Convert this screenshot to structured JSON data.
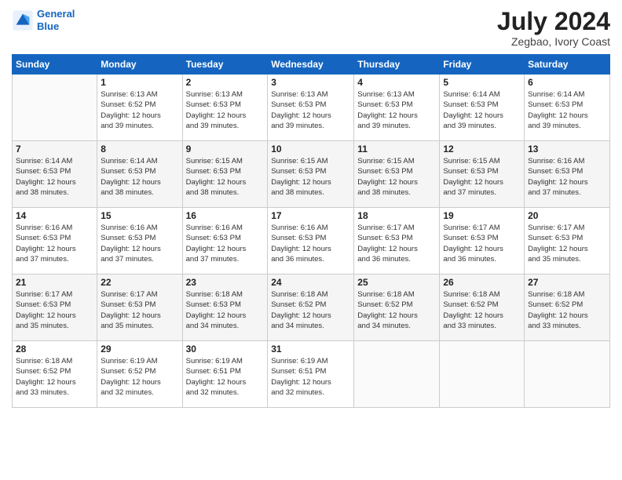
{
  "header": {
    "logo_line1": "General",
    "logo_line2": "Blue",
    "title": "July 2024",
    "subtitle": "Zegbao, Ivory Coast"
  },
  "days_of_week": [
    "Sunday",
    "Monday",
    "Tuesday",
    "Wednesday",
    "Thursday",
    "Friday",
    "Saturday"
  ],
  "weeks": [
    [
      {
        "day": "",
        "info": ""
      },
      {
        "day": "1",
        "info": "Sunrise: 6:13 AM\nSunset: 6:52 PM\nDaylight: 12 hours\nand 39 minutes."
      },
      {
        "day": "2",
        "info": "Sunrise: 6:13 AM\nSunset: 6:53 PM\nDaylight: 12 hours\nand 39 minutes."
      },
      {
        "day": "3",
        "info": "Sunrise: 6:13 AM\nSunset: 6:53 PM\nDaylight: 12 hours\nand 39 minutes."
      },
      {
        "day": "4",
        "info": "Sunrise: 6:13 AM\nSunset: 6:53 PM\nDaylight: 12 hours\nand 39 minutes."
      },
      {
        "day": "5",
        "info": "Sunrise: 6:14 AM\nSunset: 6:53 PM\nDaylight: 12 hours\nand 39 minutes."
      },
      {
        "day": "6",
        "info": "Sunrise: 6:14 AM\nSunset: 6:53 PM\nDaylight: 12 hours\nand 39 minutes."
      }
    ],
    [
      {
        "day": "7",
        "info": "Sunrise: 6:14 AM\nSunset: 6:53 PM\nDaylight: 12 hours\nand 38 minutes."
      },
      {
        "day": "8",
        "info": "Sunrise: 6:14 AM\nSunset: 6:53 PM\nDaylight: 12 hours\nand 38 minutes."
      },
      {
        "day": "9",
        "info": "Sunrise: 6:15 AM\nSunset: 6:53 PM\nDaylight: 12 hours\nand 38 minutes."
      },
      {
        "day": "10",
        "info": "Sunrise: 6:15 AM\nSunset: 6:53 PM\nDaylight: 12 hours\nand 38 minutes."
      },
      {
        "day": "11",
        "info": "Sunrise: 6:15 AM\nSunset: 6:53 PM\nDaylight: 12 hours\nand 38 minutes."
      },
      {
        "day": "12",
        "info": "Sunrise: 6:15 AM\nSunset: 6:53 PM\nDaylight: 12 hours\nand 37 minutes."
      },
      {
        "day": "13",
        "info": "Sunrise: 6:16 AM\nSunset: 6:53 PM\nDaylight: 12 hours\nand 37 minutes."
      }
    ],
    [
      {
        "day": "14",
        "info": "Sunrise: 6:16 AM\nSunset: 6:53 PM\nDaylight: 12 hours\nand 37 minutes."
      },
      {
        "day": "15",
        "info": "Sunrise: 6:16 AM\nSunset: 6:53 PM\nDaylight: 12 hours\nand 37 minutes."
      },
      {
        "day": "16",
        "info": "Sunrise: 6:16 AM\nSunset: 6:53 PM\nDaylight: 12 hours\nand 37 minutes."
      },
      {
        "day": "17",
        "info": "Sunrise: 6:16 AM\nSunset: 6:53 PM\nDaylight: 12 hours\nand 36 minutes."
      },
      {
        "day": "18",
        "info": "Sunrise: 6:17 AM\nSunset: 6:53 PM\nDaylight: 12 hours\nand 36 minutes."
      },
      {
        "day": "19",
        "info": "Sunrise: 6:17 AM\nSunset: 6:53 PM\nDaylight: 12 hours\nand 36 minutes."
      },
      {
        "day": "20",
        "info": "Sunrise: 6:17 AM\nSunset: 6:53 PM\nDaylight: 12 hours\nand 35 minutes."
      }
    ],
    [
      {
        "day": "21",
        "info": "Sunrise: 6:17 AM\nSunset: 6:53 PM\nDaylight: 12 hours\nand 35 minutes."
      },
      {
        "day": "22",
        "info": "Sunrise: 6:17 AM\nSunset: 6:53 PM\nDaylight: 12 hours\nand 35 minutes."
      },
      {
        "day": "23",
        "info": "Sunrise: 6:18 AM\nSunset: 6:53 PM\nDaylight: 12 hours\nand 34 minutes."
      },
      {
        "day": "24",
        "info": "Sunrise: 6:18 AM\nSunset: 6:52 PM\nDaylight: 12 hours\nand 34 minutes."
      },
      {
        "day": "25",
        "info": "Sunrise: 6:18 AM\nSunset: 6:52 PM\nDaylight: 12 hours\nand 34 minutes."
      },
      {
        "day": "26",
        "info": "Sunrise: 6:18 AM\nSunset: 6:52 PM\nDaylight: 12 hours\nand 33 minutes."
      },
      {
        "day": "27",
        "info": "Sunrise: 6:18 AM\nSunset: 6:52 PM\nDaylight: 12 hours\nand 33 minutes."
      }
    ],
    [
      {
        "day": "28",
        "info": "Sunrise: 6:18 AM\nSunset: 6:52 PM\nDaylight: 12 hours\nand 33 minutes."
      },
      {
        "day": "29",
        "info": "Sunrise: 6:19 AM\nSunset: 6:52 PM\nDaylight: 12 hours\nand 32 minutes."
      },
      {
        "day": "30",
        "info": "Sunrise: 6:19 AM\nSunset: 6:51 PM\nDaylight: 12 hours\nand 32 minutes."
      },
      {
        "day": "31",
        "info": "Sunrise: 6:19 AM\nSunset: 6:51 PM\nDaylight: 12 hours\nand 32 minutes."
      },
      {
        "day": "",
        "info": ""
      },
      {
        "day": "",
        "info": ""
      },
      {
        "day": "",
        "info": ""
      }
    ]
  ]
}
